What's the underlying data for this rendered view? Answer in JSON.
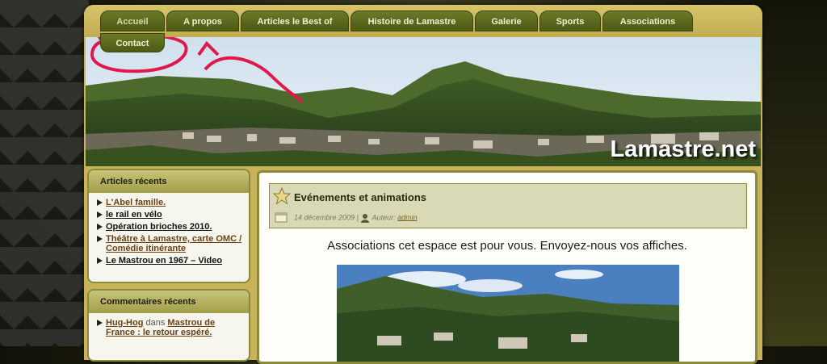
{
  "nav": {
    "tabs": [
      "Accueil",
      "A propos",
      "Articles le Best of",
      "Histoire de Lamastre",
      "Galerie",
      "Sports",
      "Associations"
    ],
    "contact": "Contact"
  },
  "banner": {
    "site_title": "Lamastre.net"
  },
  "sidebar": {
    "recent_articles": {
      "title": "Articles récents",
      "items": [
        "L'Abel famille.",
        "le rail en vélo",
        "Opération brioches 2010.",
        "Théâtre à Lamastre, carte OMC / Comédie itinérante",
        "Le Mastrou en 1967 – Video"
      ]
    },
    "recent_comments": {
      "title": "Commentaires récents",
      "item_author": "Hug-Hog",
      "item_in": "dans",
      "item_post": "Mastrou de France : le retour espéré."
    }
  },
  "post": {
    "title": "Evénements et animations",
    "date": "14 décembre 2009",
    "separator": "|",
    "author_label": "Auteur:",
    "author": "admin",
    "body": "Associations cet espace est pour vous. Envoyez-nous vos affiches."
  },
  "colors": {
    "frame": "#c9b35a",
    "tab": "#5a6820",
    "annotation": "#e0184c"
  }
}
